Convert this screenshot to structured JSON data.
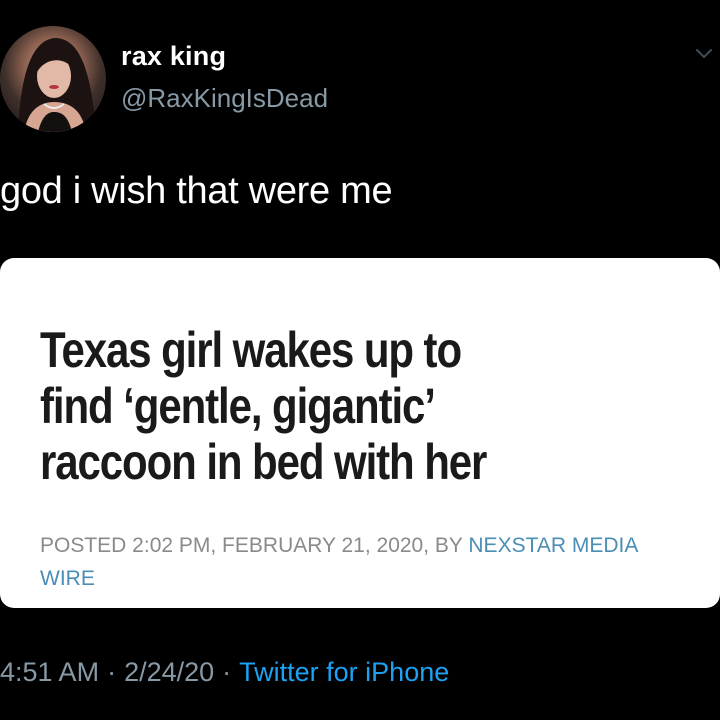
{
  "tweet": {
    "display_name": "rax king",
    "handle": "@RaxKingIsDead",
    "text": "god i wish that were me",
    "avatar_icon": "profile-photo",
    "menu_icon": "chevron-down-icon"
  },
  "article_card": {
    "headline_lines": [
      "Texas girl wakes up to",
      "find ‘gentle, gigantic’",
      "raccoon in bed with her"
    ],
    "byline_prefix": "POSTED 2:02 PM, FEBRUARY 21, 2020, BY",
    "byline_author": "NEXSTAR MEDIA WIRE",
    "author_color": "#4a8db5"
  },
  "meta": {
    "time": "4:51 AM",
    "date": "2/24/20",
    "separator": "·",
    "source": "Twitter for iPhone",
    "source_color": "#1da1f2"
  },
  "colors": {
    "background": "#000000",
    "text_primary": "#ffffff",
    "text_secondary": "#8899a6",
    "card_background": "#ffffff"
  }
}
